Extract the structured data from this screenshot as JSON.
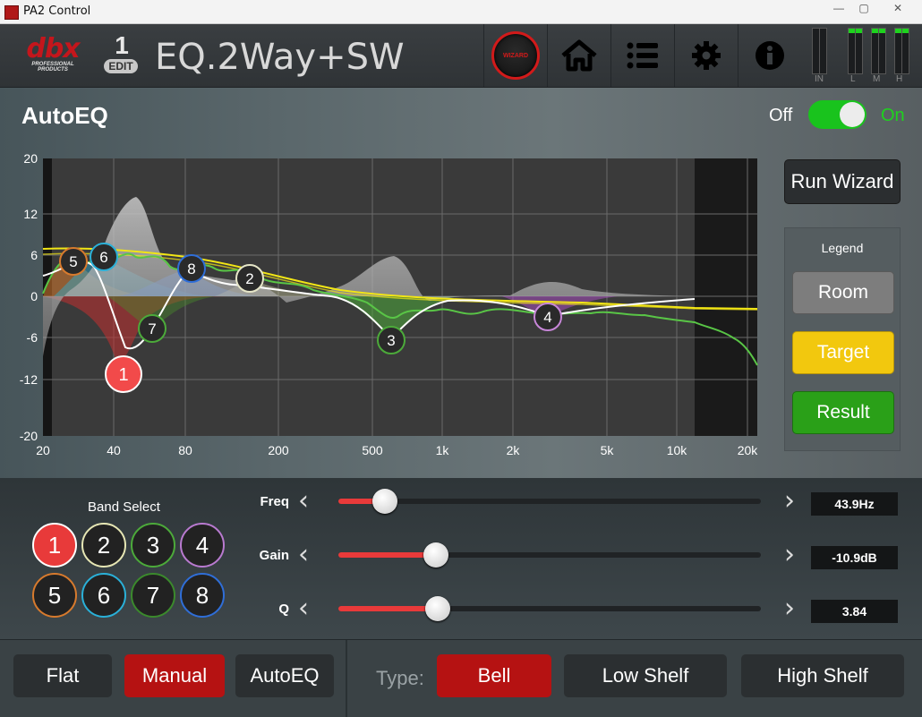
{
  "window": {
    "title": "PA2 Control",
    "minimize": "—",
    "maximize": "▢",
    "close": "✕"
  },
  "header": {
    "logo_text": "dbx",
    "logo_sub": "PROFESSIONAL PRODUCTS",
    "preset_number": "1",
    "edit_label": "EDIT",
    "preset_name": "EQ.2Way+SW",
    "wizard_label": "WIZARD",
    "meters": [
      "IN",
      "L",
      "M",
      "H"
    ]
  },
  "autoeq": {
    "title": "AutoEQ",
    "toggle_off": "Off",
    "toggle_on": "On",
    "toggle_state": "on"
  },
  "graph": {
    "y_labels": [
      "20",
      "12",
      "6",
      "0",
      "-6",
      "-12",
      "-20"
    ],
    "x_labels": [
      "20",
      "40",
      "80",
      "200",
      "500",
      "1k",
      "2k",
      "5k",
      "10k",
      "20k"
    ],
    "markers": [
      {
        "label": "1",
        "color": "#f24a4a"
      },
      {
        "label": "2",
        "color": "#e6e6c8"
      },
      {
        "label": "3",
        "color": "#4caa3a"
      },
      {
        "label": "4",
        "color": "#c786d8"
      },
      {
        "label": "5",
        "color": "#d77a2d"
      },
      {
        "label": "6",
        "color": "#2ab0d8"
      },
      {
        "label": "7",
        "color": "#4caa3a"
      },
      {
        "label": "8",
        "color": "#2f6ed8"
      }
    ]
  },
  "side": {
    "run_wizard": "Run Wizard",
    "legend_title": "Legend",
    "legend_items": [
      {
        "label": "Room",
        "color": "#7d7d7d"
      },
      {
        "label": "Target",
        "color": "#f2c80e"
      },
      {
        "label": "Result",
        "color": "#2aa018"
      }
    ]
  },
  "bands": {
    "title": "Band Select",
    "items": [
      {
        "label": "1",
        "color": "#e8e8e8",
        "selected": true
      },
      {
        "label": "2",
        "color": "#e6e6b4"
      },
      {
        "label": "3",
        "color": "#4caa3a"
      },
      {
        "label": "4",
        "color": "#b97ad0"
      },
      {
        "label": "5",
        "color": "#d77a2d"
      },
      {
        "label": "6",
        "color": "#2ab0d8"
      },
      {
        "label": "7",
        "color": "#3b8a2c"
      },
      {
        "label": "8",
        "color": "#2f6ed8"
      }
    ]
  },
  "params": [
    {
      "label": "Freq",
      "value": "43.9Hz",
      "fill": 0.11
    },
    {
      "label": "Gain",
      "value": "-10.9dB",
      "fill": 0.23
    },
    {
      "label": "Q",
      "value": "3.84",
      "fill": 0.235
    }
  ],
  "bottom": {
    "flat": "Flat",
    "manual": "Manual",
    "autoeq": "AutoEQ",
    "type_label": "Type:",
    "types": [
      "Bell",
      "Low Shelf",
      "High Shelf"
    ]
  }
}
